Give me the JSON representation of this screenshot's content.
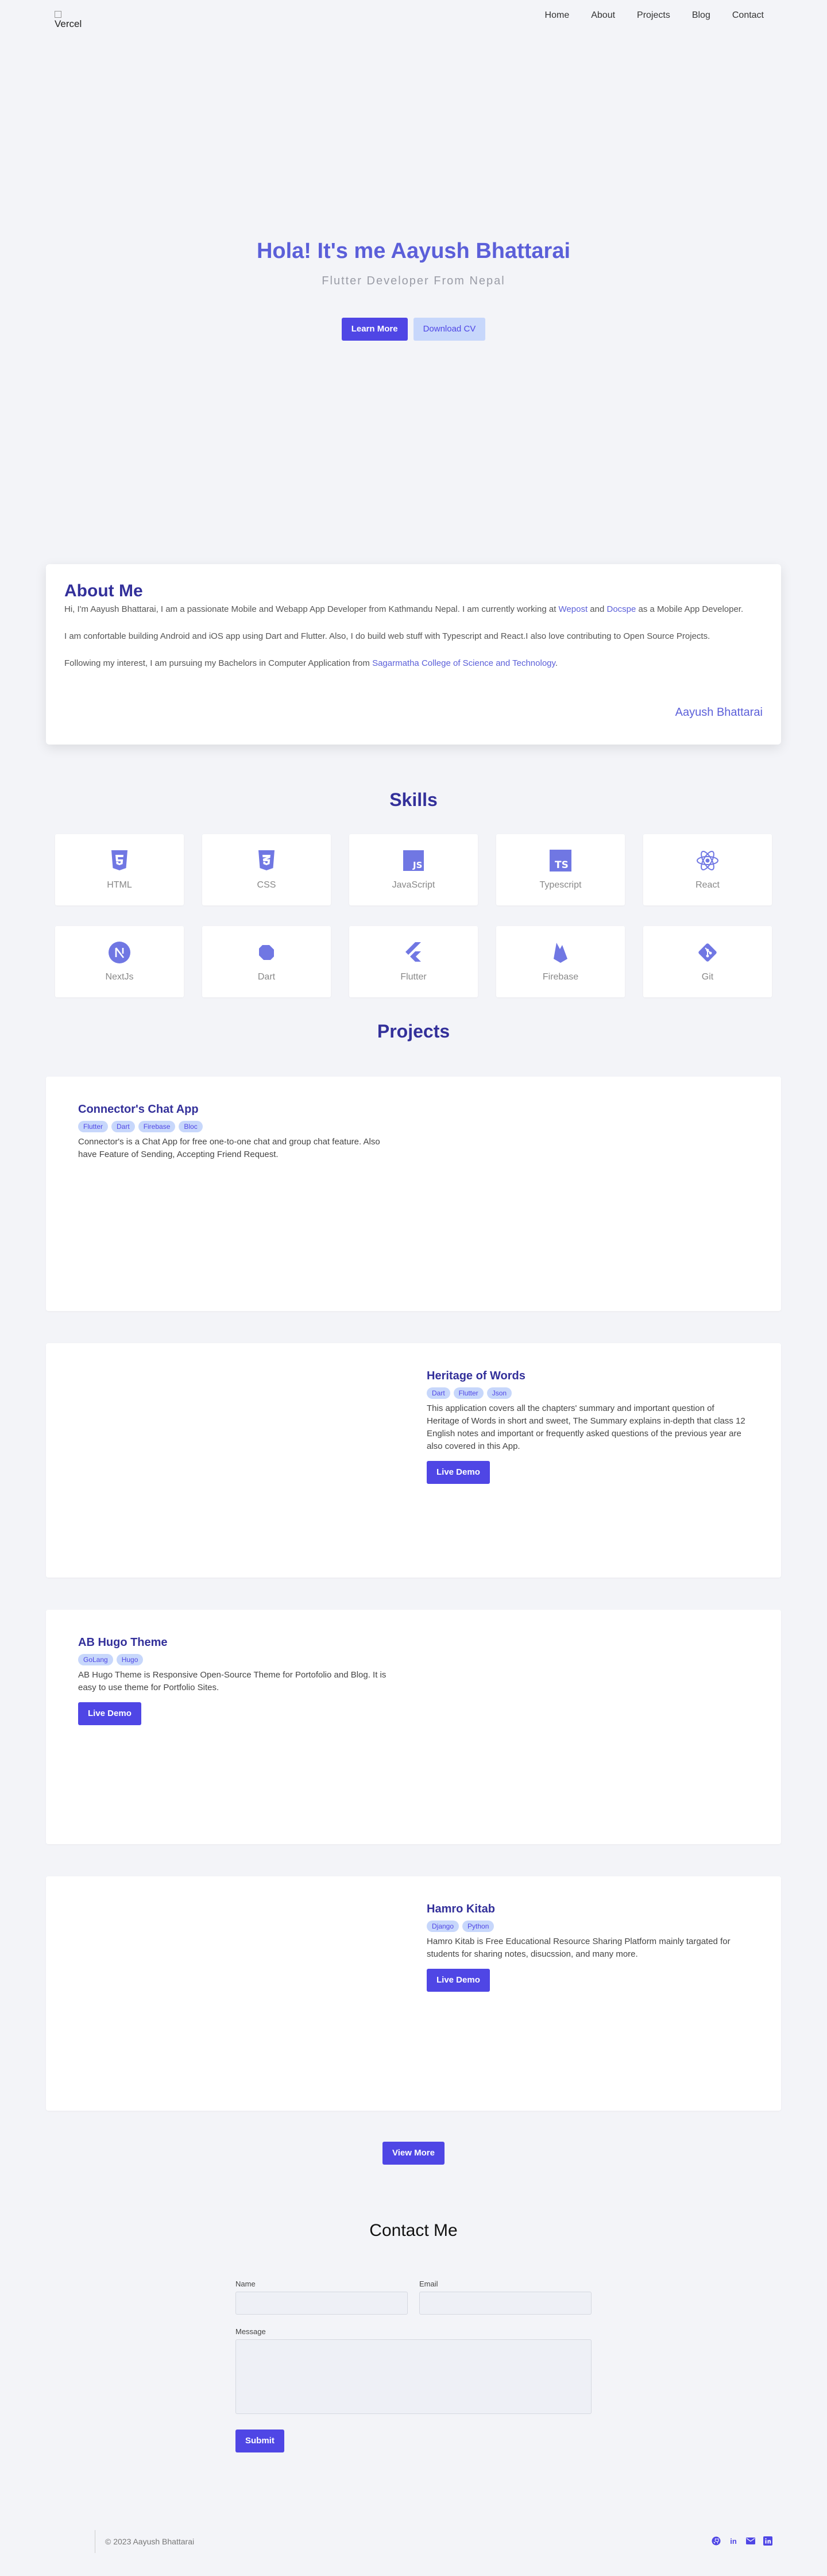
{
  "nav": {
    "logo_alt": "Vercel",
    "links": [
      "Home",
      "About",
      "Projects",
      "Blog",
      "Contact"
    ]
  },
  "hero": {
    "title": "Hola! It's me Aayush Bhattarai",
    "subtitle": "Flutter Developer From Nepal",
    "learn_more": "Learn More",
    "download_cv": "Download CV"
  },
  "about": {
    "title": "About Me",
    "p1_a": "Hi, I'm Aayush Bhattarai, I am a passionate Mobile and Webapp App Developer from Kathmandu Nepal. I am currently working at ",
    "p1_link1": "Wepost",
    "p1_b": " and ",
    "p1_link2": "Docspe",
    "p1_c": " as a Mobile App Developer.",
    "p2": "I am confortable building Android and iOS app using Dart and Flutter. Also, I do build web stuff with Typescript and React.I also love contributing to Open Source Projects.",
    "p3_a": "Following my interest, I am pursuing my Bachelors in Computer Application from ",
    "p3_link": "Sagarmatha College of Science and Technology",
    "p3_b": ".",
    "signature": "Aayush Bhattarai"
  },
  "skills": {
    "title": "Skills",
    "items": [
      "HTML",
      "CSS",
      "JavaScript",
      "Typescript",
      "React",
      "NextJs",
      "Dart",
      "Flutter",
      "Firebase",
      "Git"
    ]
  },
  "projects": {
    "title": "Projects",
    "items": [
      {
        "title": "Connector's Chat App",
        "tags": [
          "Flutter",
          "Dart",
          "Firebase",
          "Bloc"
        ],
        "desc": "Connector's is a Chat App for free one-to-one chat and group chat feature. Also have Feature of Sending, Accepting Friend Request."
      },
      {
        "title": "Heritage of Words",
        "tags": [
          "Dart",
          "Flutter",
          "Json"
        ],
        "desc": "This application covers all the chapters' summary and important question of Heritage of Words in short and sweet, The Summary explains in-depth that class 12 English notes and important or frequently asked questions of the previous year are also covered in this App.",
        "button": "Live Demo"
      },
      {
        "title": "AB Hugo Theme",
        "tags": [
          "GoLang",
          "Hugo"
        ],
        "desc": "AB Hugo Theme is Responsive Open-Source Theme for Portofolio and Blog. It is easy to use theme for Portfolio Sites.",
        "button": "Live Demo"
      },
      {
        "title": "Hamro Kitab",
        "tags": [
          "Django",
          "Python"
        ],
        "desc": "Hamro Kitab is Free Educational Resource Sharing Platform mainly targated for students for sharing notes, disucssion, and many more.",
        "button": "Live Demo"
      }
    ],
    "view_more": "View More"
  },
  "contact": {
    "title": "Contact Me",
    "name_label": "Name",
    "email_label": "Email",
    "message_label": "Message",
    "submit": "Submit"
  },
  "footer": {
    "copyright": "© 2023 Aayush Bhattarai",
    "social_icons": [
      "github-icon",
      "linkedin-icon",
      "mail-icon",
      "linkedin-box-icon"
    ]
  },
  "colors": {
    "accent": "#4f46e5",
    "title": "#33309a",
    "icon": "#7077e3",
    "background": "#f3f4f8"
  }
}
